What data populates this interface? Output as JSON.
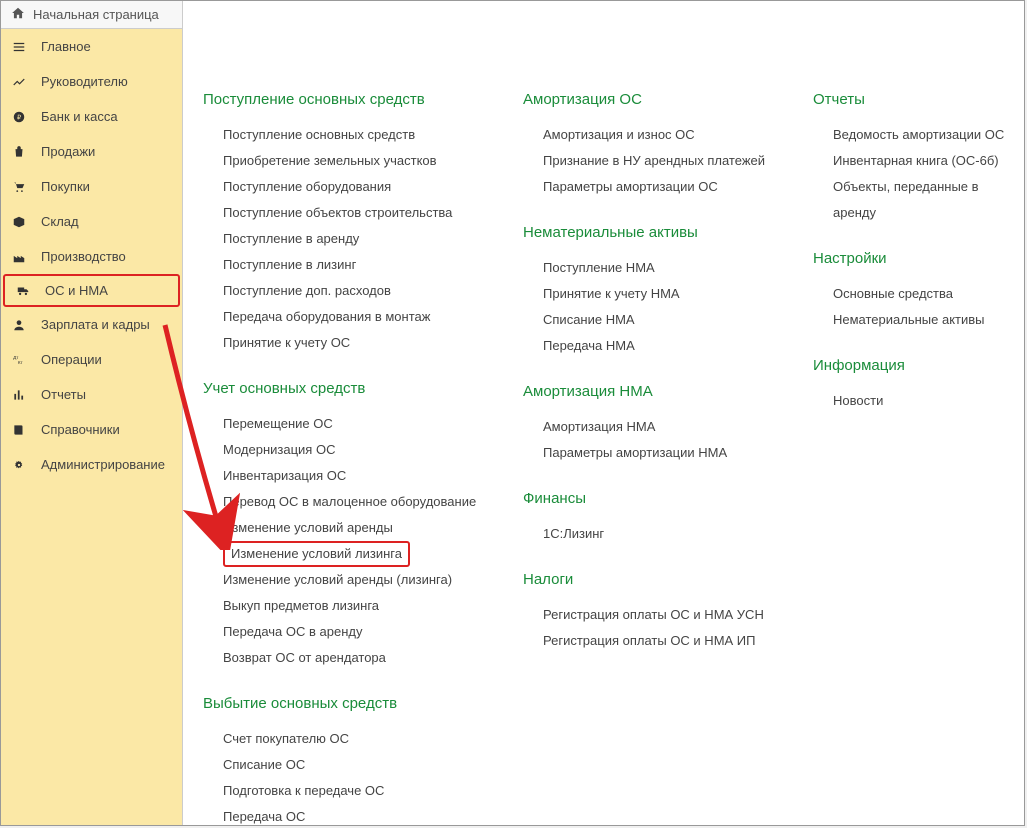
{
  "homebar": {
    "label": "Начальная страница"
  },
  "sidebar": {
    "items": [
      {
        "label": "Главное"
      },
      {
        "label": "Руководителю"
      },
      {
        "label": "Банк и касса"
      },
      {
        "label": "Продажи"
      },
      {
        "label": "Покупки"
      },
      {
        "label": "Склад"
      },
      {
        "label": "Производство"
      },
      {
        "label": "ОС и НМА"
      },
      {
        "label": "Зарплата и кадры"
      },
      {
        "label": "Операции"
      },
      {
        "label": "Отчеты"
      },
      {
        "label": "Справочники"
      },
      {
        "label": "Администрирование"
      }
    ]
  },
  "col1": {
    "sec1": {
      "title": "Поступление основных средств",
      "items": [
        "Поступление основных средств",
        "Приобретение земельных участков",
        "Поступление оборудования",
        "Поступление объектов строительства",
        "Поступление в аренду",
        "Поступление в лизинг",
        "Поступление доп. расходов",
        "Передача оборудования в монтаж",
        "Принятие к учету ОС"
      ]
    },
    "sec2": {
      "title": "Учет основных средств",
      "items": [
        "Перемещение ОС",
        "Модернизация ОС",
        "Инвентаризация ОС",
        "Перевод ОС в малоценное оборудование",
        "Изменение условий аренды",
        "Изменение условий лизинга",
        "Изменение условий аренды (лизинга)",
        "Выкуп предметов лизинга",
        "Передача ОС в аренду",
        "Возврат ОС от арендатора"
      ]
    },
    "sec3": {
      "title": "Выбытие основных средств",
      "items": [
        "Счет покупателю ОС",
        "Списание ОС",
        "Подготовка к передаче ОС",
        "Передача ОС"
      ]
    }
  },
  "col2": {
    "sec1": {
      "title": "Амортизация ОС",
      "items": [
        "Амортизация и износ ОС",
        "Признание в НУ арендных платежей",
        "Параметры амортизации ОС"
      ]
    },
    "sec2": {
      "title": "Нематериальные активы",
      "items": [
        "Поступление НМА",
        "Принятие к учету НМА",
        "Списание НМА",
        "Передача НМА"
      ]
    },
    "sec3": {
      "title": "Амортизация НМА",
      "items": [
        "Амортизация НМА",
        "Параметры амортизации НМА"
      ]
    },
    "sec4": {
      "title": "Финансы",
      "items": [
        "1С:Лизинг"
      ]
    },
    "sec5": {
      "title": "Налоги",
      "items": [
        "Регистрация оплаты ОС и НМА УСН",
        "Регистрация оплаты ОС и НМА ИП"
      ]
    }
  },
  "col3": {
    "sec1": {
      "title": "Отчеты",
      "items": [
        "Ведомость амортизации ОС",
        "Инвентарная книга (ОС-6б)",
        "Объекты, переданные в аренду"
      ]
    },
    "sec2": {
      "title": "Настройки",
      "items": [
        "Основные средства",
        "Нематериальные активы"
      ]
    },
    "sec3": {
      "title": "Информация",
      "items": [
        "Новости"
      ]
    }
  }
}
